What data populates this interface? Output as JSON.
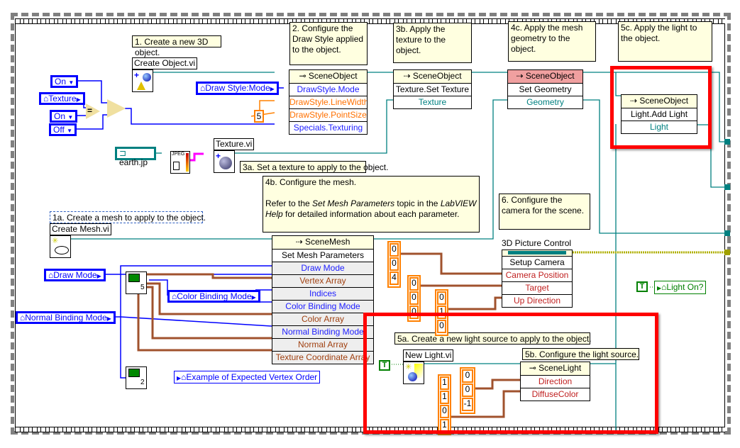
{
  "comments": {
    "step1": "1. Create a new 3D object.",
    "step2": "2. Configure the Draw Style applied to the object.",
    "step3a": "3a. Set a texture to apply to the object.",
    "step3b": "3b. Apply the texture to the object.",
    "step4b_line1": "4b. Configure the mesh.",
    "step4b_line2a": "Refer to the ",
    "step4b_italic1": "Set Mesh Parameters",
    "step4b_line2b": " topic in the ",
    "step4b_italic2": "LabVIEW Help",
    "step4b_line2c": " for detailed information about each parameter.",
    "step4c": "4c. Apply the mesh geometry to the object.",
    "step5a": "5a. Create a new light source to apply to the object.",
    "step5b": "5b. Configure the light source.",
    "step5c": "5c. Apply the light to the object.",
    "step6": "6. Configure the camera for the scene.",
    "step1a": "1a. Create a mesh to apply to the object."
  },
  "subvis": {
    "create_object": "Create Object.vi",
    "texture": "Texture.vi",
    "create_mesh": "Create Mesh.vi",
    "new_light": "New Light.vi",
    "mesh_sub1_index": "5",
    "mesh_sub2_index": "2",
    "jpeg": "JPEG"
  },
  "controls": {
    "on1": "On",
    "texture": "Texture",
    "on2": "On",
    "off": "Off",
    "draw_style_mode": "Draw Style:Mode",
    "path": "earth.jp",
    "draw_mode": "Draw Mode",
    "normal_binding_mode": "Normal Binding Mode",
    "color_binding_mode": "Color Binding Mode",
    "example_vertex_order": "Example of Expected Vertex Order",
    "light_on": "Light On?",
    "true_const": "T"
  },
  "constants": {
    "point_size": "5",
    "camera_position": [
      "0",
      "0",
      "4"
    ],
    "target": [
      "0",
      "0",
      "0"
    ],
    "up_direction": [
      "0",
      "1",
      "0"
    ],
    "light_direction": [
      "0",
      "0",
      "-1"
    ],
    "diffuse_color": [
      "1",
      "1",
      "0",
      "1"
    ]
  },
  "nodes": {
    "draw_style": {
      "class": "SceneObject",
      "rows": [
        "DrawStyle.Mode",
        "DrawStyle.LineWidth",
        "DrawStyle.PointSize",
        "Specials.Texturing"
      ]
    },
    "set_texture": {
      "class": "SceneObject",
      "method": "Texture.Set Texture",
      "param": "Texture"
    },
    "set_geometry": {
      "class": "SceneObject",
      "method": "Set Geometry",
      "param": "Geometry"
    },
    "add_light": {
      "class": "SceneObject",
      "method": "Light.Add Light",
      "param": "Light"
    },
    "mesh": {
      "class": "SceneMesh",
      "method": "Set Mesh Parameters",
      "rows": [
        "Draw Mode",
        "Vertex Array",
        "Indices",
        "Color Binding Mode",
        "Color Array",
        "Normal Binding Mode",
        "Normal Array",
        "Texture Coordinate Array"
      ]
    },
    "camera": {
      "label": "3D Picture Control",
      "method": "Setup Camera",
      "rows": [
        "Camera Position",
        "Target",
        "Up Direction"
      ]
    },
    "light": {
      "class": "SceneLight",
      "rows": [
        "Direction",
        "DiffuseColor"
      ]
    }
  },
  "colors": {
    "enum_wire": "#0000ff",
    "refnum_wire": "#008080",
    "numeric_wire": "#ff8000",
    "array_wire": "#a0522d",
    "highlight": "#ff0000",
    "comment_bg": "#ffffe0"
  }
}
